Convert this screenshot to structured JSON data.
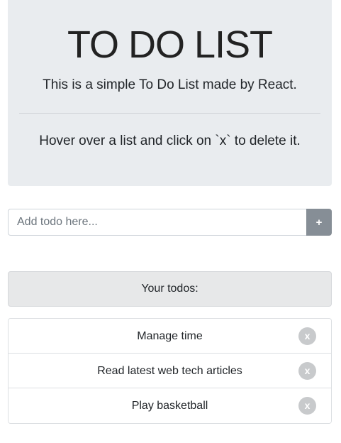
{
  "header": {
    "title": "TO DO LIST",
    "subtitle": "This is a simple To Do List made by React.",
    "hint": "Hover over a list and click on `x` to delete it."
  },
  "form": {
    "placeholder": "Add todo here...",
    "value": "",
    "add_label": "+"
  },
  "todos": {
    "heading": "Your todos:",
    "items": [
      {
        "label": "Manage time",
        "delete_label": "x"
      },
      {
        "label": "Read latest web tech articles",
        "delete_label": "x"
      },
      {
        "label": "Play basketball",
        "delete_label": "x"
      }
    ]
  },
  "colors": {
    "jumbotron_bg": "#e9ecef",
    "add_button_bg": "#868e96",
    "delete_button_bg": "#c8cacc"
  }
}
